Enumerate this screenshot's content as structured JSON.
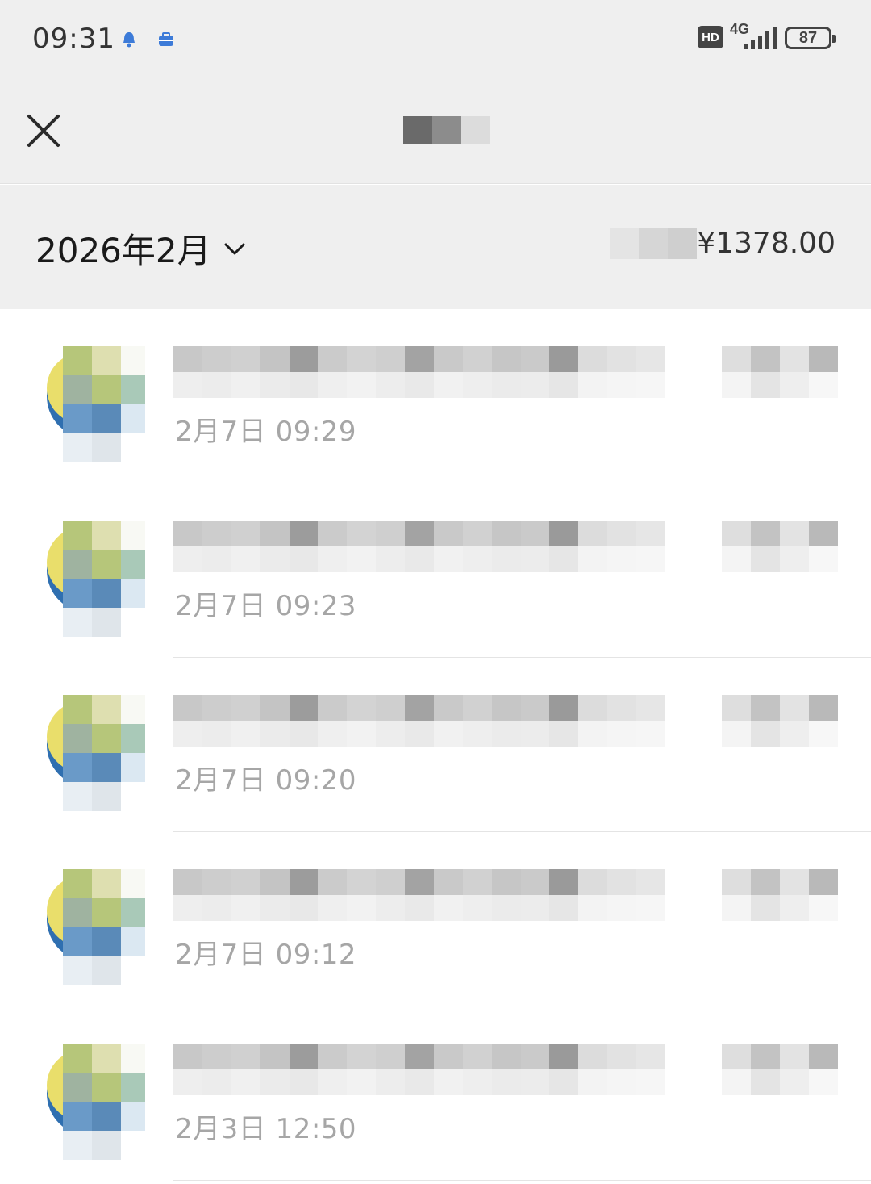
{
  "status_bar": {
    "time": "09:31",
    "hd_label": "HD",
    "network_label": "4G",
    "battery_level": "87",
    "icons": [
      "bell-notification-icon",
      "briefcase-notification-icon",
      "hd-icon",
      "signal-icon",
      "battery-icon"
    ]
  },
  "header": {
    "close_icon": "close-icon",
    "title": ""
  },
  "filter": {
    "month_label": "2026年2月",
    "dropdown_icon": "chevron-down-icon",
    "total_amount": "¥1378.00"
  },
  "transactions": [
    {
      "description": "",
      "amount": "",
      "time": "2月7日 09:29"
    },
    {
      "description": "",
      "amount": "",
      "time": "2月7日 09:23"
    },
    {
      "description": "",
      "amount": "",
      "time": "2月7日 09:20"
    },
    {
      "description": "",
      "amount": "",
      "time": "2月7日 09:12"
    },
    {
      "description": "",
      "amount": "",
      "time": "2月3日 12:50"
    }
  ],
  "colors": {
    "header_background": "#efefef",
    "list_background": "#ffffff",
    "time_text": "#a6a6a6",
    "divider": "#e4e4e4"
  }
}
